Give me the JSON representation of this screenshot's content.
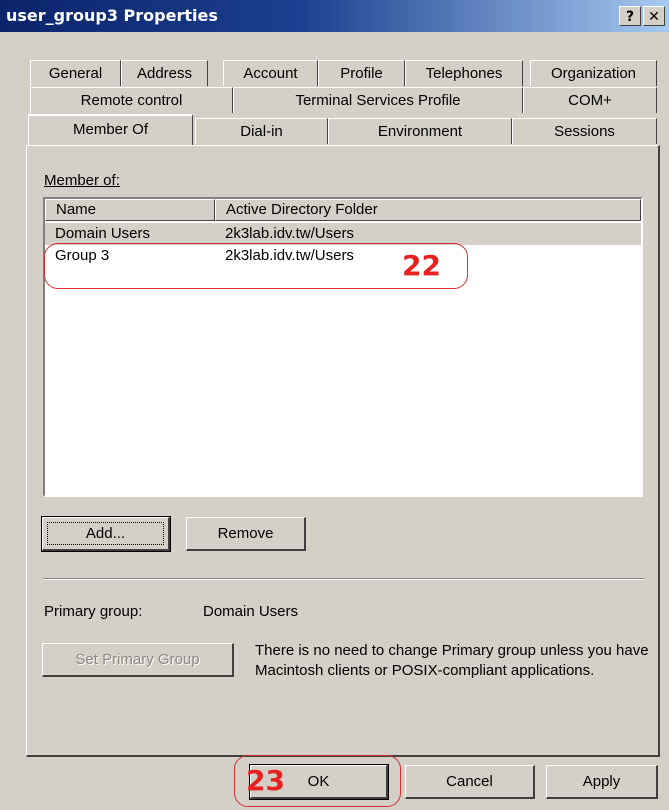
{
  "window": {
    "title": "user_group3 Properties",
    "help_button": "?",
    "close_button": "✕"
  },
  "tabs": {
    "row1": [
      "General",
      "Address",
      "Account",
      "Profile",
      "Telephones",
      "Organization"
    ],
    "row2": [
      "Remote control",
      "Terminal Services Profile",
      "COM+"
    ],
    "row3": [
      "Member Of",
      "Dial-in",
      "Environment",
      "Sessions"
    ],
    "active": "Member Of"
  },
  "member_of": {
    "label": "Member of:",
    "columns": [
      "Name",
      "Active Directory Folder"
    ],
    "rows": [
      {
        "name": "Domain Users",
        "folder": "2k3lab.idv.tw/Users"
      },
      {
        "name": "Group 3",
        "folder": "2k3lab.idv.tw/Users"
      }
    ]
  },
  "buttons": {
    "add": "Add...",
    "remove": "Remove",
    "set_primary_group": "Set Primary Group",
    "ok": "OK",
    "cancel": "Cancel",
    "apply": "Apply"
  },
  "primary_group": {
    "label": "Primary group:",
    "value": "Domain Users",
    "note": "There is no need to change Primary group unless you have Macintosh clients or POSIX-compliant applications."
  },
  "annotations": [
    "22",
    "23"
  ],
  "colors": {
    "title_bar_start": "#0a246a",
    "title_bar_end": "#a6caf0",
    "annotation": "#e82020",
    "face": "#d4d0c8"
  }
}
